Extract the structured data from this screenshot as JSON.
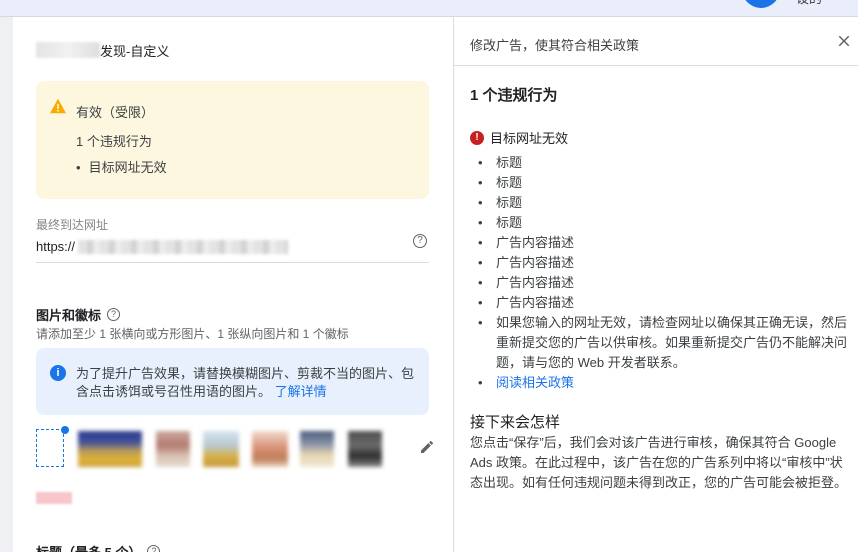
{
  "topbar": {
    "cut_label": "设的"
  },
  "ad_editor": {
    "ad_type": "发现-自定义",
    "status": {
      "label": "有效（受限）",
      "violation_count": "1 个违规行为",
      "issue": "目标网址无效"
    },
    "final_url": {
      "label": "最终到达网址",
      "prefix": "https://"
    },
    "images": {
      "heading": "图片和徽标",
      "requirement": "请添加至少 1 张横向或方形图片、1 张纵向图片和 1 个徽标",
      "info": "为了提升广告效果，请替换模糊图片、剪裁不当的图片、包含点击诱饵或号召性用语的图片。",
      "learn_more": "了解详情"
    },
    "headlines_label": "标题（最多 5 个）"
  },
  "policy_panel": {
    "title": "修改广告，使其符合相关政策",
    "violations_heading": "1 个违规行为",
    "violation": "目标网址无效",
    "fields": [
      "标题",
      "标题",
      "标题",
      "标题",
      "广告内容描述",
      "广告内容描述",
      "广告内容描述",
      "广告内容描述"
    ],
    "advice": "如果您输入的网址无效，请检查网址以确保其正确无误，然后重新提交您的广告以供审核。如果重新提交广告仍不能解决问题，请与您的 Web 开发者联系。",
    "policy_link": "阅读相关政策",
    "next_heading": "接下来会怎样",
    "next_body": "您点击“保存”后，我们会对该广告进行审核，确保其符合 Google Ads 政策。在此过程中，该广告在您的广告系列中将以“审核中”状态出现。如有任何违规问题未得到改正，您的广告可能会被拒登。"
  },
  "colors": {
    "accent": "#1a73e8",
    "warning_bg": "#fef7e0",
    "warning_icon": "#f9ab00",
    "info_bg": "#e8f0fe",
    "error": "#c5221f"
  },
  "icons": [
    "warning-icon",
    "help-icon",
    "info-icon",
    "edit-icon",
    "close-icon",
    "error-icon"
  ]
}
